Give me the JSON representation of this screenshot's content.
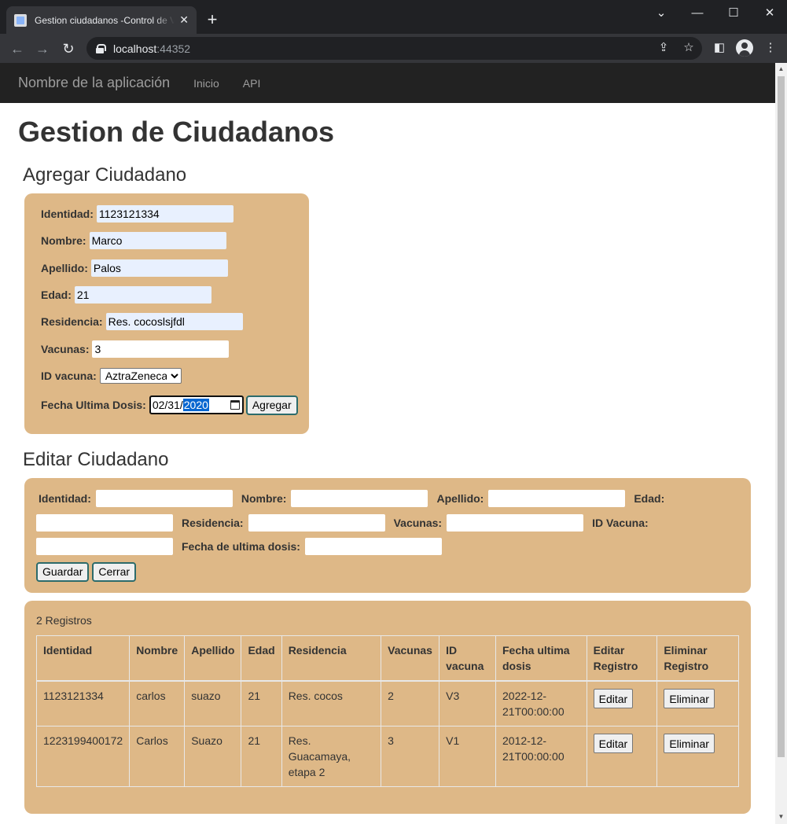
{
  "browser": {
    "tab_title": "Gestion ciudadanos -Control de Vacunas",
    "url_host": "localhost",
    "url_port": ":44352",
    "icons": [
      "back-icon",
      "forward-icon",
      "reload-icon",
      "lock-icon",
      "share-icon",
      "star-icon",
      "side-panel-icon",
      "profile-icon",
      "menu-icon"
    ]
  },
  "navbar": {
    "brand": "Nombre de la aplicación",
    "links": [
      "Inicio",
      "API"
    ]
  },
  "page": {
    "title": "Gestion de Ciudadanos"
  },
  "add_form": {
    "title": "Agregar Ciudadano",
    "identidad_label": "Identidad:",
    "identidad_value": "1123121334",
    "nombre_label": "Nombre:",
    "nombre_value": "Marco",
    "apellido_label": "Apellido:",
    "apellido_value": "Palos",
    "edad_label": "Edad:",
    "edad_value": "21",
    "residencia_label": "Residencia:",
    "residencia_value": "Res. cocoslsjfdl",
    "vacunas_label": "Vacunas:",
    "vacunas_value": "3",
    "id_vacuna_label": "ID vacuna:",
    "id_vacuna_value": "AztraZeneca",
    "fecha_label": "Fecha Ultima Dosis:",
    "fecha_mm": "02",
    "fecha_dd": "31",
    "fecha_yyyy": "2020",
    "submit_label": "Agregar"
  },
  "edit_form": {
    "title": "Editar Ciudadano",
    "identidad_label": "Identidad:",
    "nombre_label": "Nombre:",
    "apellido_label": "Apellido:",
    "edad_label": "Edad:",
    "residencia_label": "Residencia:",
    "vacunas_label": "Vacunas:",
    "id_vacuna_label": "ID Vacuna:",
    "fecha_label": "Fecha de ultima dosis:",
    "save_label": "Guardar",
    "close_label": "Cerrar"
  },
  "records": {
    "count_text": "2 Registros",
    "headers": [
      "Identidad",
      "Nombre",
      "Apellido",
      "Edad",
      "Residencia",
      "Vacunas",
      "ID vacuna",
      "Fecha ultima dosis",
      "Editar Registro",
      "Eliminar Registro"
    ],
    "edit_label": "Editar",
    "delete_label": "Eliminar",
    "rows": [
      [
        "1123121334",
        "carlos",
        "suazo",
        "21",
        "Res. cocos",
        "2",
        "V3",
        "2022-12-21T00:00:00"
      ],
      [
        "1223199400172",
        "Carlos",
        "Suazo",
        "21",
        "Res. Guacamaya, etapa 2",
        "3",
        "V1",
        "2012-12-21T00:00:00"
      ]
    ]
  },
  "colors": {
    "panel": "#deb887",
    "navbar": "#222222",
    "button_border": "#2c6b6b",
    "autofill": "#e8f0fe"
  }
}
